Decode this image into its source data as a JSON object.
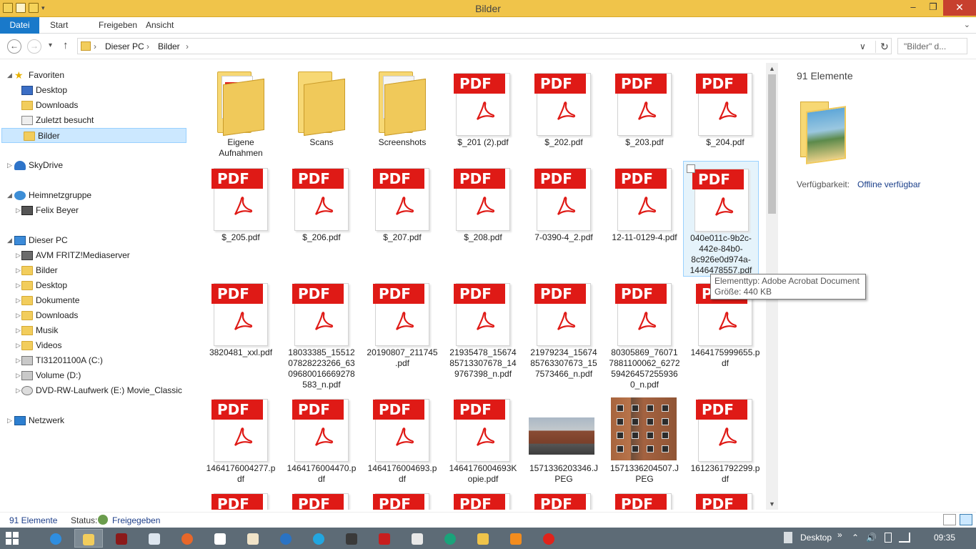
{
  "window": {
    "title": "Bilder",
    "minimize": "–",
    "maximize": "❐",
    "close": "✕"
  },
  "ribbon": {
    "tabs": [
      "Datei",
      "Start",
      "Freigeben",
      "Ansicht"
    ],
    "expand": "⌄"
  },
  "address": {
    "back": "←",
    "forward": "→",
    "recent": "▾",
    "up": "↑",
    "crumbs": [
      "Dieser PC",
      "Bilder"
    ],
    "sep": "›",
    "dropdown": "∨",
    "refresh": "↻",
    "search_placeholder": "\"Bilder\" d..."
  },
  "nav": {
    "items": [
      {
        "label": "Favoriten",
        "icon": "star-icon",
        "level": 0,
        "expanded": true
      },
      {
        "label": "Desktop",
        "icon": "desktop-icon",
        "level": 1
      },
      {
        "label": "Downloads",
        "icon": "downloads-icon",
        "level": 1
      },
      {
        "label": "Zuletzt besucht",
        "icon": "recent-places-icon",
        "level": 1
      },
      {
        "label": "Bilder",
        "icon": "pictures-folder-icon",
        "level": 1,
        "selected": true
      },
      {
        "label": "SkyDrive",
        "icon": "skydrive-icon",
        "level": 0
      },
      {
        "label": "Heimnetzgruppe",
        "icon": "homegroup-icon",
        "level": 0,
        "expanded": true
      },
      {
        "label": "Felix Beyer",
        "icon": "user-icon",
        "level": 1
      },
      {
        "label": "Dieser PC",
        "icon": "computer-icon",
        "level": 0,
        "expanded": true
      },
      {
        "label": "AVM FRITZ!Mediaserver",
        "icon": "media-server-icon",
        "level": 1
      },
      {
        "label": "Bilder",
        "icon": "pictures-folder-icon",
        "level": 1
      },
      {
        "label": "Desktop",
        "icon": "desktop-folder-icon",
        "level": 1
      },
      {
        "label": "Dokumente",
        "icon": "documents-folder-icon",
        "level": 1
      },
      {
        "label": "Downloads",
        "icon": "downloads-folder-icon",
        "level": 1
      },
      {
        "label": "Musik",
        "icon": "music-folder-icon",
        "level": 1
      },
      {
        "label": "Videos",
        "icon": "videos-folder-icon",
        "level": 1
      },
      {
        "label": "TI31201100A (C:)",
        "icon": "system-drive-icon",
        "level": 1
      },
      {
        "label": "Volume (D:)",
        "icon": "drive-icon",
        "level": 1
      },
      {
        "label": "DVD-RW-Laufwerk (E:) Movie_Classic",
        "icon": "dvd-drive-icon",
        "level": 1
      },
      {
        "label": "Netzwerk",
        "icon": "network-icon",
        "level": 0
      }
    ]
  },
  "files": [
    {
      "name": "Eigene Aufnahmen",
      "type": "folder-pdf"
    },
    {
      "name": "Scans",
      "type": "folder"
    },
    {
      "name": "Screenshots",
      "type": "folder-doc"
    },
    {
      "name": "$_201 (2).pdf",
      "type": "pdf"
    },
    {
      "name": "$_202.pdf",
      "type": "pdf"
    },
    {
      "name": "$_203.pdf",
      "type": "pdf"
    },
    {
      "name": "$_204.pdf",
      "type": "pdf"
    },
    {
      "name": "$_205.pdf",
      "type": "pdf"
    },
    {
      "name": "$_206.pdf",
      "type": "pdf"
    },
    {
      "name": "$_207.pdf",
      "type": "pdf"
    },
    {
      "name": "$_208.pdf",
      "type": "pdf"
    },
    {
      "name": "7-0390-4_2.pdf",
      "type": "pdf"
    },
    {
      "name": "12-11-0129-4.pdf",
      "type": "pdf"
    },
    {
      "name": "040e011c-9b2c-442e-84b0-8c926e0d974a-1446478557.pdf",
      "type": "pdf",
      "selected": true
    },
    {
      "name": "3820481_xxl.pdf",
      "type": "pdf"
    },
    {
      "name": "18033385_1551207828223266_6309680016669278583_n.pdf",
      "type": "pdf"
    },
    {
      "name": "20190807_211745.pdf",
      "type": "pdf"
    },
    {
      "name": "21935478_1567485713307678_149767398_n.pdf",
      "type": "pdf"
    },
    {
      "name": "21979234_1567485763307673_157573466_n.pdf",
      "type": "pdf"
    },
    {
      "name": "80305869_760717881100062_6272594264572559360_n.pdf",
      "type": "pdf"
    },
    {
      "name": "1464175999655.pdf",
      "type": "pdf"
    },
    {
      "name": "1464176004277.pdf",
      "type": "pdf"
    },
    {
      "name": "1464176004470.pdf",
      "type": "pdf"
    },
    {
      "name": "1464176004693.pdf",
      "type": "pdf"
    },
    {
      "name": "1464176004693Kopie.pdf",
      "type": "pdf"
    },
    {
      "name": "1571336203346.JPEG",
      "type": "photo"
    },
    {
      "name": "1571336204507.JPEG",
      "type": "photo2"
    },
    {
      "name": "1612361792299.pdf",
      "type": "pdf"
    },
    {
      "name": "",
      "type": "pdf"
    },
    {
      "name": "",
      "type": "pdf"
    },
    {
      "name": "",
      "type": "pdf"
    },
    {
      "name": "",
      "type": "pdf"
    },
    {
      "name": "",
      "type": "pdf"
    },
    {
      "name": "",
      "type": "pdf"
    },
    {
      "name": "",
      "type": "pdf"
    }
  ],
  "pdf_badge": "PDF",
  "folder_badge": "PDF",
  "tooltip": {
    "line1": "Elementtyp: Adobe Acrobat Document",
    "line2": "Größe: 440 KB"
  },
  "details": {
    "count": "91 Elemente",
    "availability_label": "Verfügbarkeit:",
    "availability_value": "Offline verfügbar"
  },
  "status": {
    "count": "91 Elemente",
    "status_label": "Status:",
    "status_value": "Freigegeben"
  },
  "taskbar": {
    "desktop_label": "Desktop",
    "overflow": "»",
    "clock": "09:35"
  },
  "colors": {
    "title_bar": "#f0c44a",
    "accent": "#1979ca",
    "pdf_red": "#df1a16",
    "selection": "#cce8ff",
    "taskbar": "#5d6b76"
  }
}
